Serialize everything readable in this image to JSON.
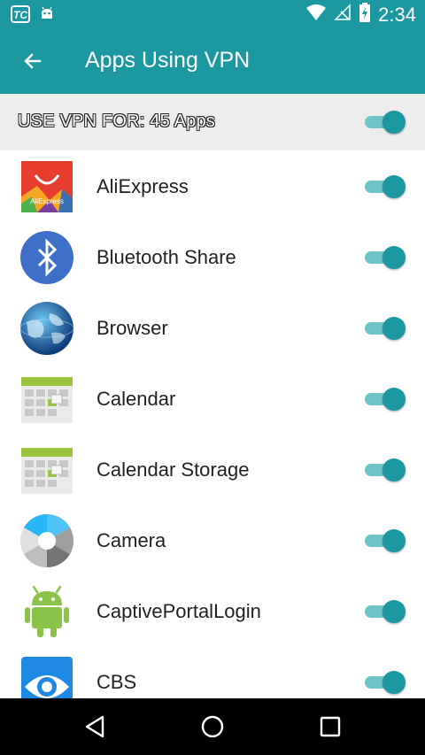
{
  "status_bar": {
    "time": "2:34",
    "left_icons": [
      "tc-icon",
      "android-notification-icon"
    ],
    "right_icons": [
      "wifi-icon",
      "no-signal-icon",
      "battery-charging-icon"
    ]
  },
  "app_bar": {
    "back_icon": "arrow-back-icon",
    "title": "Apps Using VPN"
  },
  "summary": {
    "label": "USE VPN FOR: 45 Apps",
    "enabled": true
  },
  "apps": [
    {
      "name": "AliExpress",
      "icon": "aliexpress-icon",
      "icon_text": "AliExpress",
      "enabled": true
    },
    {
      "name": "Bluetooth Share",
      "icon": "bluetooth-icon",
      "enabled": true
    },
    {
      "name": "Browser",
      "icon": "globe-icon",
      "enabled": true
    },
    {
      "name": "Calendar",
      "icon": "calendar-icon",
      "enabled": true
    },
    {
      "name": "Calendar Storage",
      "icon": "calendar-storage-icon",
      "enabled": true
    },
    {
      "name": "Camera",
      "icon": "camera-icon",
      "enabled": true
    },
    {
      "name": "CaptivePortalLogin",
      "icon": "android-robot-icon",
      "enabled": true
    },
    {
      "name": "CBS",
      "icon": "cbs-eye-icon",
      "enabled": true
    }
  ],
  "nav_bar": {
    "buttons": [
      "back-triangle-icon",
      "home-circle-icon",
      "recents-square-icon"
    ]
  },
  "colors": {
    "primary": "#1b97a0",
    "toggle_track": "#6fc3c9",
    "summary_bg": "#ededed",
    "nav_bg": "#000000"
  }
}
